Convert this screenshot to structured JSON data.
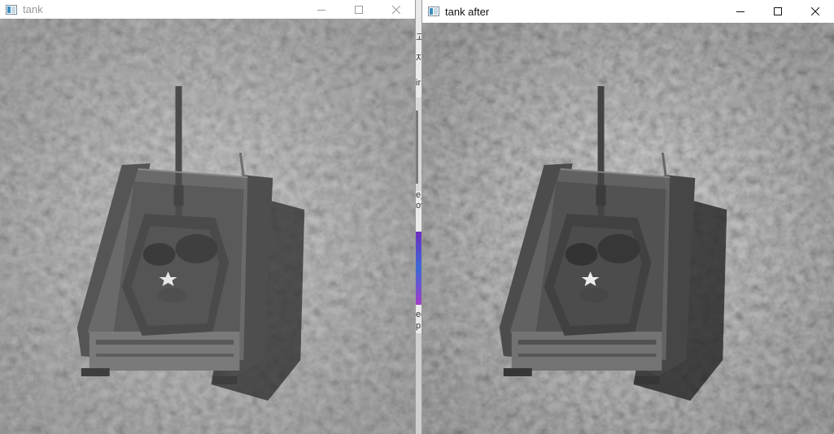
{
  "windows": {
    "left": {
      "title": "tank",
      "icon": "app-window-icon",
      "controls": [
        "minimize-icon",
        "maximize-icon",
        "close-icon"
      ]
    },
    "right": {
      "title": "tank after",
      "icon": "app-window-icon",
      "controls": [
        "minimize-icon",
        "maximize-icon",
        "close-icon"
      ]
    }
  },
  "background_fragments": [
    "고",
    "자",
    "ir",
    "e_",
    "ov",
    "eg",
    "p"
  ],
  "colors": {
    "inactive_title": "#9a9a9a",
    "active_title": "#111111",
    "purple_fragment": "#6d2fbf"
  }
}
